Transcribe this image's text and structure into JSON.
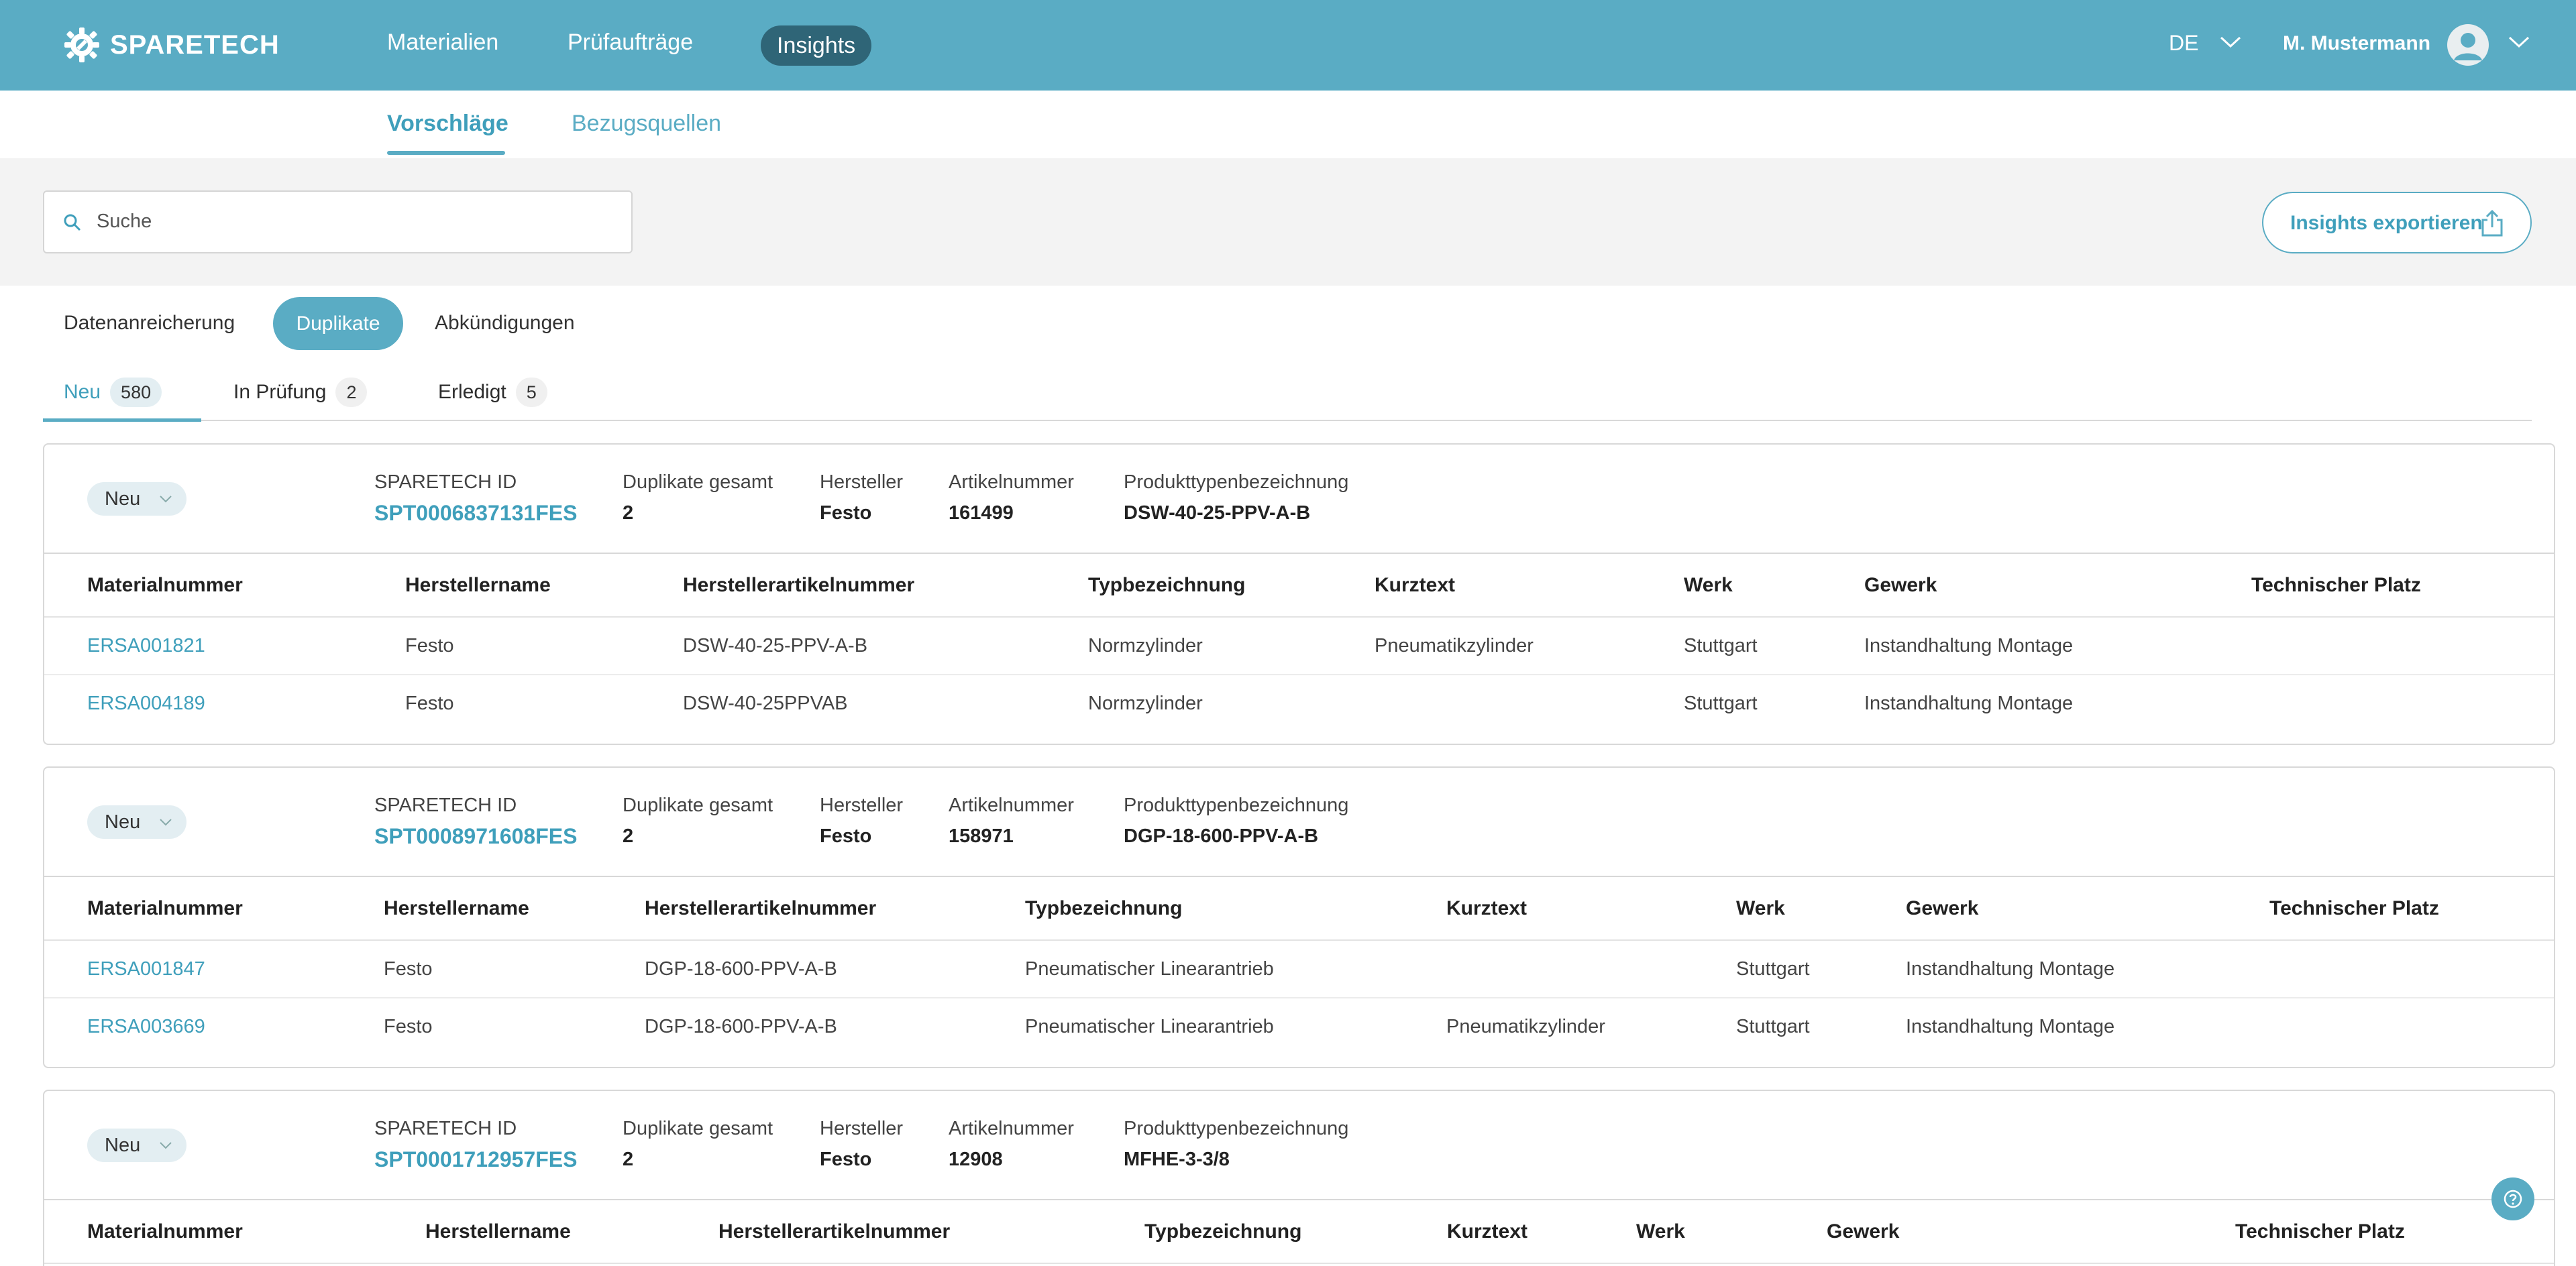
{
  "header": {
    "brand": "SPARETECH",
    "nav": [
      "Materialien",
      "Prüfaufträge",
      "Insights"
    ],
    "lang": "DE",
    "user": "M. Mustermann"
  },
  "subtabs": [
    "Vorschläge",
    "Bezugsquellen"
  ],
  "search": {
    "placeholder": "Suche"
  },
  "export_label": "Insights exportieren",
  "categories": [
    "Datenanreicherung",
    "Duplikate",
    "Abkündigungen"
  ],
  "status_tabs": [
    {
      "label": "Neu",
      "count": "580"
    },
    {
      "label": "In Prüfung",
      "count": "2"
    },
    {
      "label": "Erledigt",
      "count": "5"
    }
  ],
  "meta_labels": {
    "id": "SPARETECH ID",
    "total": "Duplikate gesamt",
    "maker": "Hersteller",
    "article": "Artikelnummer",
    "product": "Produkttypenbezeichnung"
  },
  "columns": [
    "Materialnummer",
    "Herstellername",
    "Herstellerartikelnummer",
    "Typbezeichnung",
    "Kurztext",
    "Werk",
    "Gewerk",
    "Technischer Platz"
  ],
  "cards": [
    {
      "status": "Neu",
      "id": "SPT0006837131FES",
      "total": "2",
      "maker": "Festo",
      "article": "161499",
      "product": "DSW-40-25-PPV-A-B",
      "rows": [
        [
          "ERSA001821",
          "Festo",
          "DSW-40-25-PPV-A-B",
          "Normzylinder",
          "Pneumatikzylinder",
          "Stuttgart",
          "Instandhaltung Montage",
          ""
        ],
        [
          "ERSA004189",
          "Festo",
          "DSW-40-25PPVAB",
          "Normzylinder",
          "",
          "Stuttgart",
          "Instandhaltung Montage",
          ""
        ]
      ]
    },
    {
      "status": "Neu",
      "id": "SPT0008971608FES",
      "total": "2",
      "maker": "Festo",
      "article": "158971",
      "product": "DGP-18-600-PPV-A-B",
      "rows": [
        [
          "ERSA001847",
          "Festo",
          "DGP-18-600-PPV-A-B",
          "Pneumatischer Linearantrieb",
          "",
          "Stuttgart",
          "Instandhaltung Montage",
          ""
        ],
        [
          "ERSA003669",
          "Festo",
          "DGP-18-600-PPV-A-B",
          "Pneumatischer Linearantrieb",
          "Pneumatikzylinder",
          "Stuttgart",
          "Instandhaltung Montage",
          ""
        ]
      ]
    },
    {
      "status": "Neu",
      "id": "SPT0001712957FES",
      "total": "2",
      "maker": "Festo",
      "article": "12908",
      "product": "MFHE-3-3/8",
      "rows": []
    }
  ],
  "colors": {
    "brand": "#5aacc4",
    "brand_dark": "#2f6577",
    "link": "#3f9fbb"
  }
}
